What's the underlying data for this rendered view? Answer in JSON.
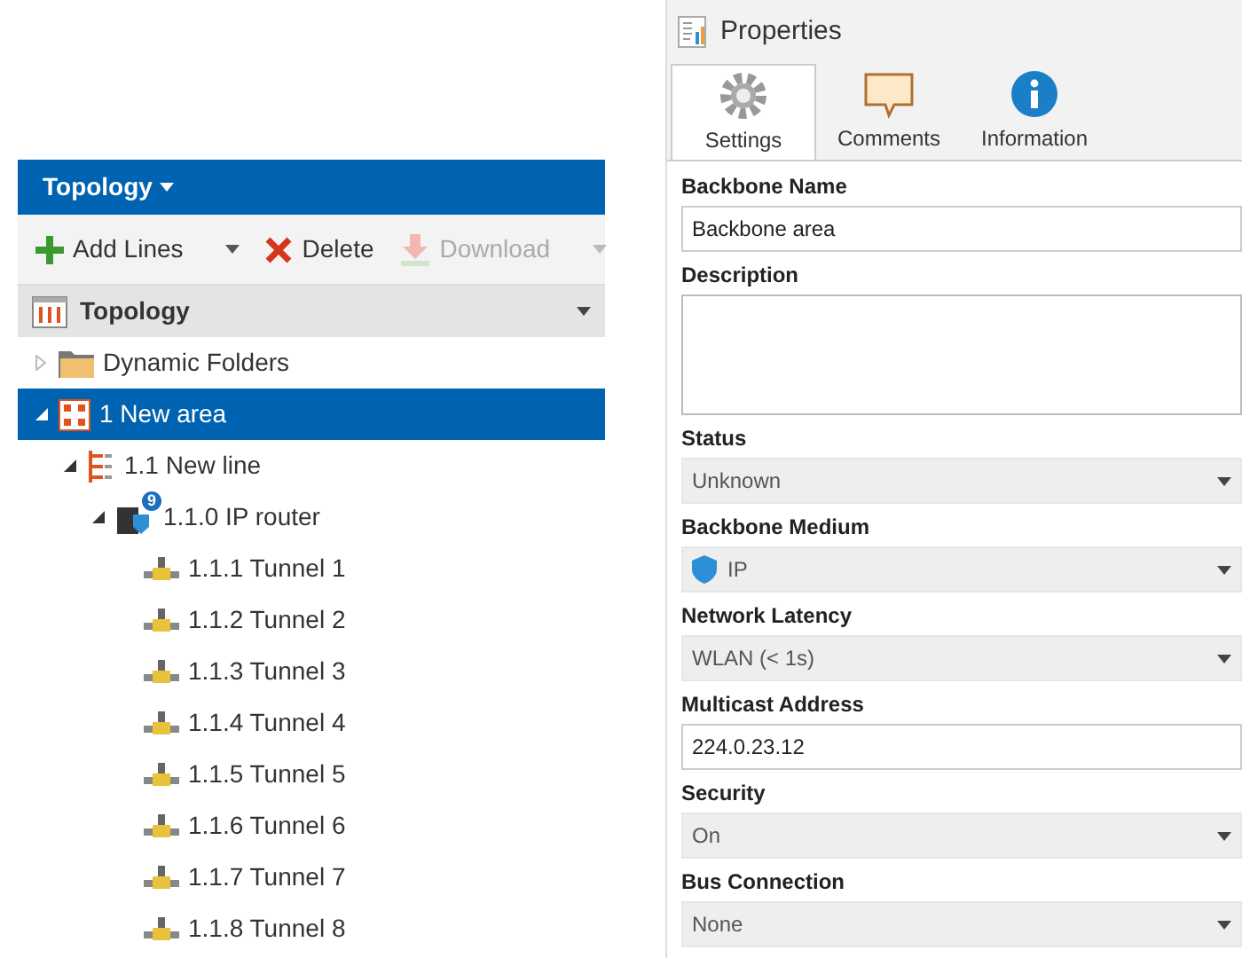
{
  "topology_panel": {
    "title": "Topology",
    "toolbar": [
      {
        "kind": "add",
        "label": "Add Lines",
        "disabled": false,
        "split": true
      },
      {
        "kind": "delete",
        "label": "Delete",
        "disabled": false,
        "split": false
      },
      {
        "kind": "download",
        "label": "Download",
        "disabled": true,
        "split": true
      }
    ],
    "tree_header": "Topology",
    "tree": [
      {
        "kind": "folder",
        "label": "Dynamic Folders",
        "expanded": false,
        "selected": false
      },
      {
        "kind": "area",
        "label": "1 New area",
        "expanded": true,
        "selected": true,
        "children": [
          {
            "kind": "line",
            "label": "1.1 New line",
            "expanded": true,
            "selected": false,
            "children": [
              {
                "kind": "router",
                "label": "1.1.0 IP router",
                "badge": "9",
                "expanded": true,
                "selected": false,
                "children": [
                  {
                    "kind": "tunnel",
                    "label": "1.1.1 Tunnel 1",
                    "selected": false
                  },
                  {
                    "kind": "tunnel",
                    "label": "1.1.2 Tunnel 2",
                    "selected": false
                  },
                  {
                    "kind": "tunnel",
                    "label": "1.1.3 Tunnel 3",
                    "selected": false
                  },
                  {
                    "kind": "tunnel",
                    "label": "1.1.4 Tunnel 4",
                    "selected": false
                  },
                  {
                    "kind": "tunnel",
                    "label": "1.1.5 Tunnel 5",
                    "selected": false
                  },
                  {
                    "kind": "tunnel",
                    "label": "1.1.6 Tunnel 6",
                    "selected": false
                  },
                  {
                    "kind": "tunnel",
                    "label": "1.1.7 Tunnel 7",
                    "selected": false
                  },
                  {
                    "kind": "tunnel",
                    "label": "1.1.8 Tunnel 8",
                    "selected": false
                  }
                ]
              }
            ]
          }
        ]
      }
    ]
  },
  "properties_panel": {
    "title": "Properties",
    "tabs": [
      {
        "kind": "settings",
        "label": "Settings",
        "selected": true
      },
      {
        "kind": "comments",
        "label": "Comments",
        "selected": false
      },
      {
        "kind": "information",
        "label": "Information",
        "selected": false
      }
    ],
    "fields": [
      {
        "kind": "text",
        "label": "Backbone Name",
        "value": "Backbone area",
        "disabled": false
      },
      {
        "kind": "textarea",
        "label": "Description",
        "disabled": false
      },
      {
        "kind": "select",
        "label": "Status",
        "value": "Unknown",
        "disabled": true
      },
      {
        "kind": "shield-select",
        "label": "Backbone Medium",
        "value": "IP",
        "disabled": true
      },
      {
        "kind": "select",
        "label": "Network Latency",
        "value": "WLAN (< 1s)",
        "disabled": true
      },
      {
        "kind": "text",
        "label": "Multicast Address",
        "value": "224.0.23.12",
        "disabled": false
      },
      {
        "kind": "select",
        "label": "Security",
        "value": "On",
        "disabled": true
      },
      {
        "kind": "select",
        "label": "Bus Connection",
        "value": "None",
        "disabled": true
      }
    ]
  }
}
